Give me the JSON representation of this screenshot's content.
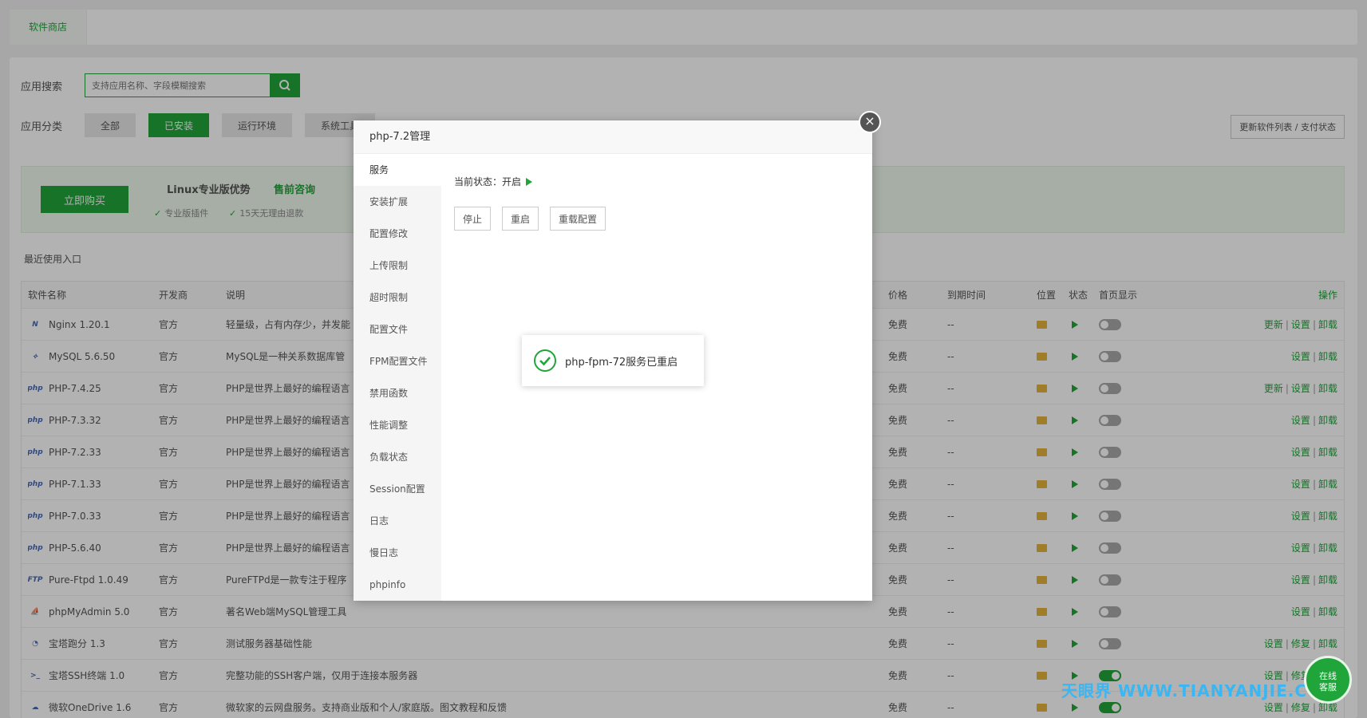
{
  "topbar": {
    "tab_label": "软件商店"
  },
  "search": {
    "label": "应用搜索",
    "placeholder": "支持应用名称、字段模糊搜索"
  },
  "categories": {
    "label": "应用分类",
    "items": [
      "全部",
      "已安装",
      "运行环境",
      "系统工具"
    ]
  },
  "update_button": "更新软件列表 / 支付状态",
  "promo": {
    "buy_label": "立即购买",
    "title": "Linux专业版优势",
    "consult": "售前咨询",
    "features": [
      "专业版插件",
      "15天无理由退款"
    ]
  },
  "recent_label": "最近使用入口",
  "table": {
    "headers": {
      "name": "软件名称",
      "dev": "开发商",
      "desc": "说明",
      "price": "价格",
      "expire": "到期时间",
      "pos": "位置",
      "status": "状态",
      "home": "首页显示",
      "op": "操作"
    },
    "rows": [
      {
        "name": "Nginx 1.20.1",
        "dev": "官方",
        "desc": "轻量级，占有内存少，并发能",
        "price": "免费",
        "expire": "--",
        "home_on": false,
        "ops": [
          "更新",
          "设置",
          "卸载"
        ]
      },
      {
        "name": "MySQL 5.6.50",
        "dev": "官方",
        "desc": "MySQL是一种关系数据库管",
        "price": "免费",
        "expire": "--",
        "home_on": false,
        "ops": [
          "设置",
          "卸载"
        ]
      },
      {
        "name": "PHP-7.4.25",
        "dev": "官方",
        "desc": "PHP是世界上最好的编程语言",
        "price": "免费",
        "expire": "--",
        "home_on": false,
        "ops": [
          "更新",
          "设置",
          "卸载"
        ]
      },
      {
        "name": "PHP-7.3.32",
        "dev": "官方",
        "desc": "PHP是世界上最好的编程语言",
        "price": "免费",
        "expire": "--",
        "home_on": false,
        "ops": [
          "设置",
          "卸载"
        ]
      },
      {
        "name": "PHP-7.2.33",
        "dev": "官方",
        "desc": "PHP是世界上最好的编程语言",
        "price": "免费",
        "expire": "--",
        "home_on": false,
        "ops": [
          "设置",
          "卸载"
        ]
      },
      {
        "name": "PHP-7.1.33",
        "dev": "官方",
        "desc": "PHP是世界上最好的编程语言",
        "price": "免费",
        "expire": "--",
        "home_on": false,
        "ops": [
          "设置",
          "卸载"
        ]
      },
      {
        "name": "PHP-7.0.33",
        "dev": "官方",
        "desc": "PHP是世界上最好的编程语言",
        "price": "免费",
        "expire": "--",
        "home_on": false,
        "ops": [
          "设置",
          "卸载"
        ]
      },
      {
        "name": "PHP-5.6.40",
        "dev": "官方",
        "desc": "PHP是世界上最好的编程语言",
        "price": "免费",
        "expire": "--",
        "home_on": false,
        "ops": [
          "设置",
          "卸载"
        ]
      },
      {
        "name": "Pure-Ftpd 1.0.49",
        "dev": "官方",
        "desc": "PureFTPd是一款专注于程序",
        "price": "免费",
        "expire": "--",
        "home_on": false,
        "ops": [
          "设置",
          "卸载"
        ]
      },
      {
        "name": "phpMyAdmin 5.0",
        "dev": "官方",
        "desc": "著名Web端MySQL管理工具",
        "price": "免费",
        "expire": "--",
        "home_on": false,
        "ops": [
          "设置",
          "卸载"
        ]
      },
      {
        "name": "宝塔跑分 1.3",
        "dev": "官方",
        "desc": "测试服务器基础性能",
        "price": "免费",
        "expire": "--",
        "home_on": false,
        "ops": [
          "设置",
          "修复",
          "卸载"
        ]
      },
      {
        "name": "宝塔SSH终端 1.0",
        "dev": "官方",
        "desc": "完整功能的SSH客户端，仅用于连接本服务器",
        "price": "免费",
        "expire": "--",
        "home_on": true,
        "ops": [
          "设置",
          "修复",
          "卸载"
        ]
      },
      {
        "name": "微软OneDrive 1.6",
        "dev": "官方",
        "desc": "微软家的云网盘服务。支持商业版和个人/家庭版。图文教程和反馈",
        "price": "免费",
        "expire": "--",
        "home_on": true,
        "ops": [
          "设置",
          "修复",
          "卸载"
        ]
      }
    ]
  },
  "dialog": {
    "title": "php-7.2管理",
    "close": "×",
    "menu": [
      "服务",
      "安装扩展",
      "配置修改",
      "上传限制",
      "超时限制",
      "配置文件",
      "FPM配置文件",
      "禁用函数",
      "性能调整",
      "负载状态",
      "Session配置",
      "日志",
      "慢日志",
      "phpinfo"
    ],
    "status_text": "当前状态：开启",
    "buttons": [
      "停止",
      "重启",
      "重载配置"
    ]
  },
  "toast": {
    "message": "php-fpm-72服务已重启"
  },
  "watermark": "天眼界 WWW.TIANYANJIE.COM",
  "chat": {
    "line1": "在线",
    "line2": "客服"
  },
  "colors": {
    "accent": "#20a53a",
    "watermark": "#3ab6f2"
  }
}
